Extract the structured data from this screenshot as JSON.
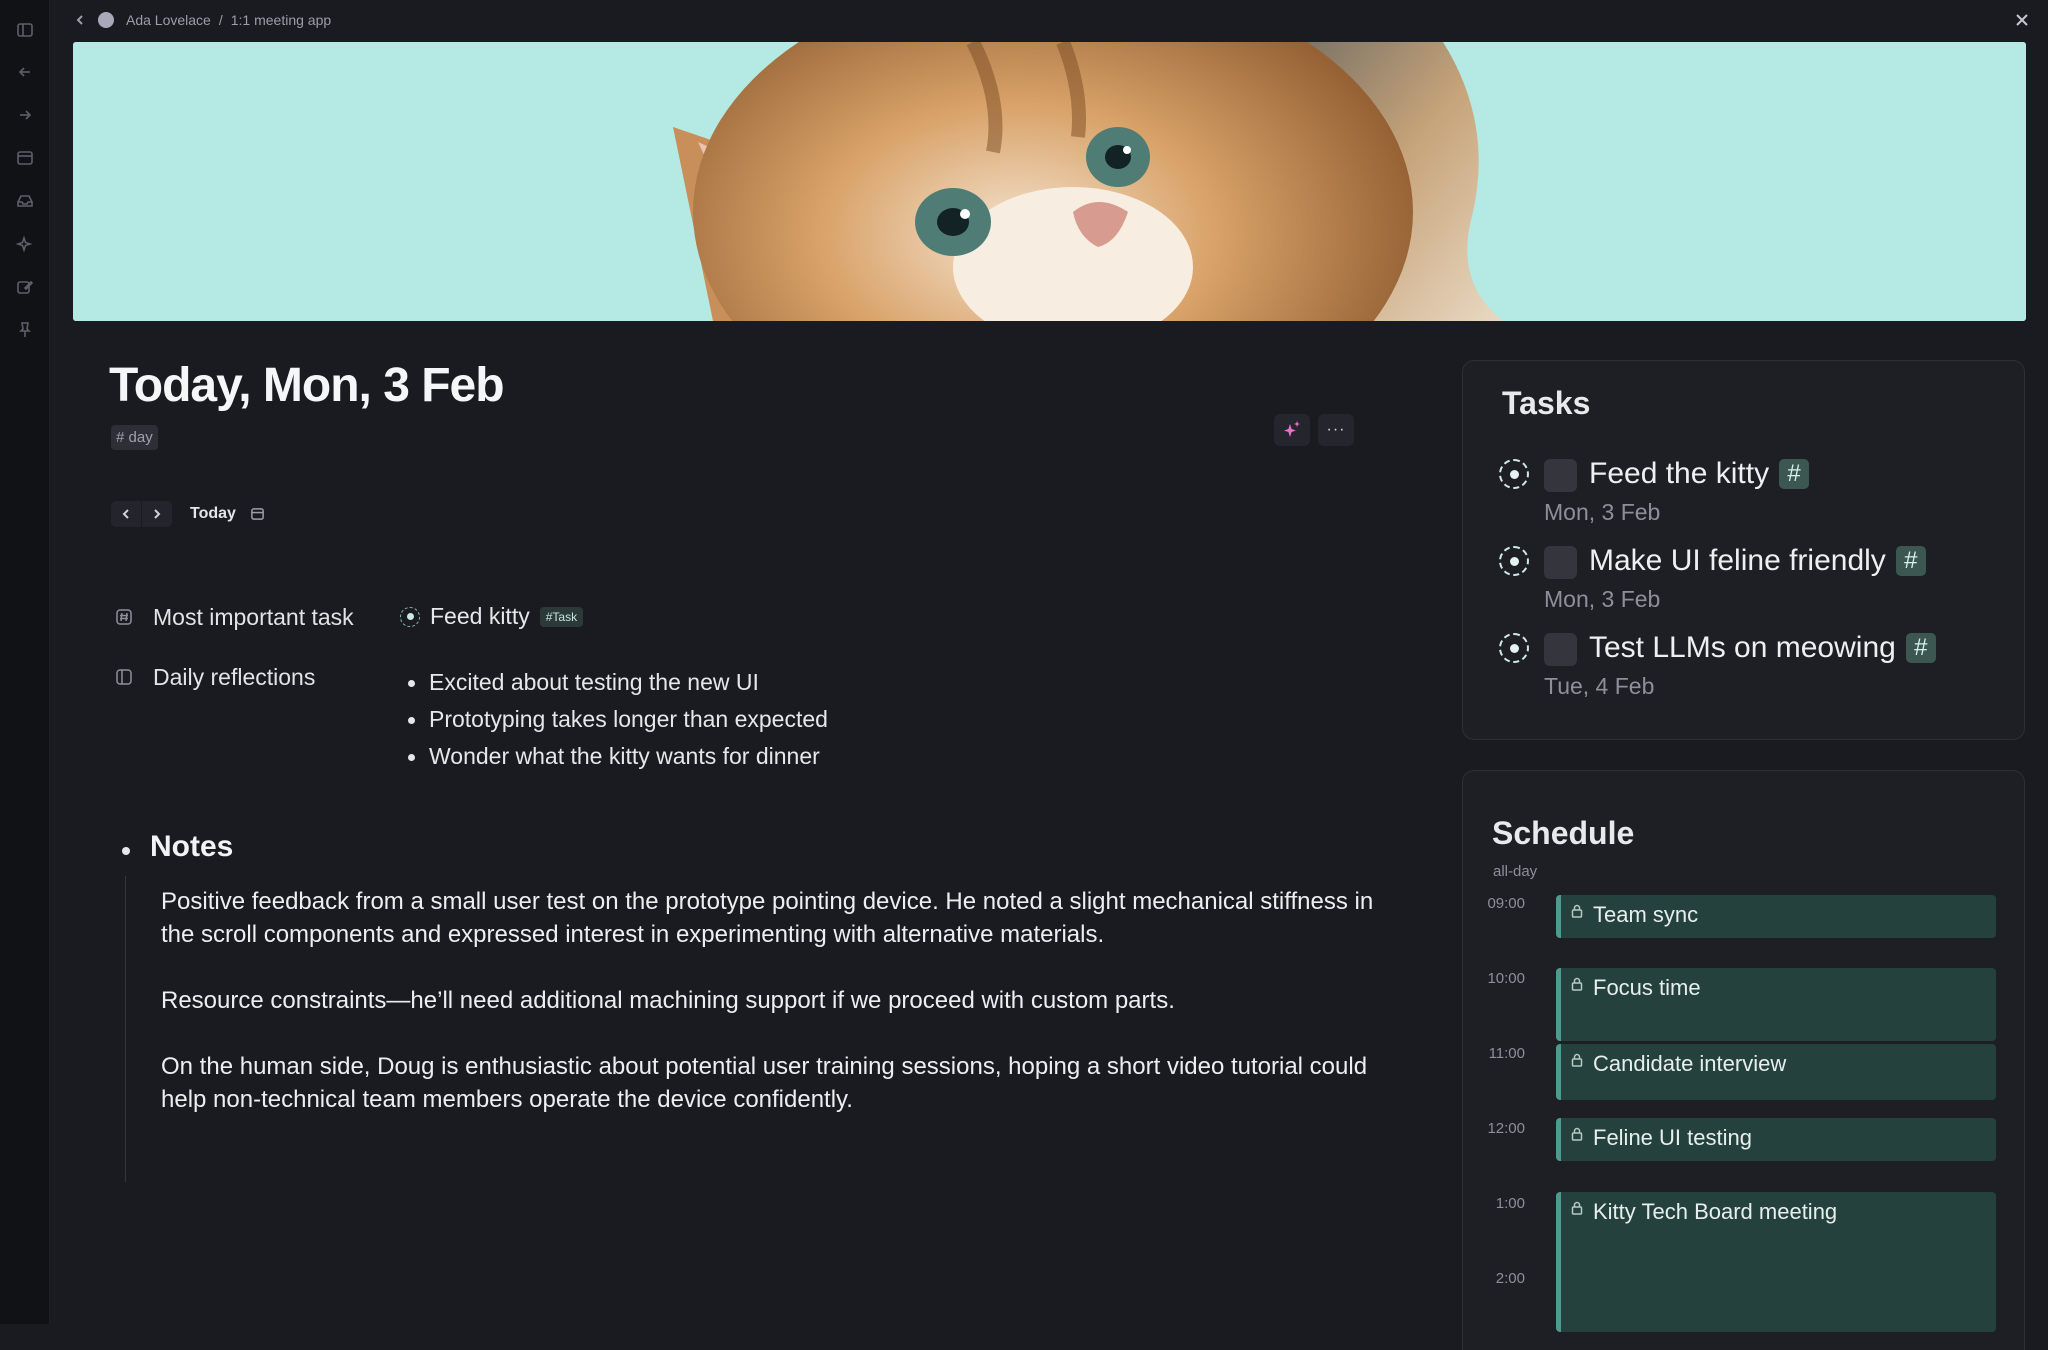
{
  "breadcrumb": {
    "user": "Ada Lovelace",
    "separator": "/",
    "page": "1:1 meeting app"
  },
  "rail_icons": [
    "sidebar-toggle-icon",
    "arrow-left-icon",
    "arrow-right-icon",
    "calendar-icon",
    "inbox-icon",
    "sparkle-icon",
    "edit-icon",
    "pin-icon"
  ],
  "header": {
    "title": "Today, Mon, 3 Feb",
    "tag": "# day",
    "today_label": "Today",
    "more_label": "···"
  },
  "properties": {
    "most_important_task": {
      "label": "Most important task",
      "value": "Feed kitty",
      "tag": "#Task"
    },
    "daily_reflections": {
      "label": "Daily reflections",
      "items": [
        "Excited about testing the new UI",
        "Prototyping takes longer than expected",
        "Wonder what the kitty wants for dinner"
      ]
    }
  },
  "notes": {
    "heading": "Notes",
    "paragraphs": [
      "Positive feedback from a small user test on the prototype pointing device. He noted a slight mechanical stiffness in the scroll components and expressed interest in experimenting with alternative materials.",
      "Resource constraints—he’ll need additional machining support if we proceed with custom parts.",
      "On the human side, Doug is enthusiastic about potential user training sessions, hoping a short video tutorial could help non-technical team members operate the device confidently."
    ]
  },
  "tasks": {
    "title": "Tasks",
    "items": [
      {
        "title": "Feed the kitty",
        "date": "Mon, 3 Feb",
        "hash": "#"
      },
      {
        "title": "Make UI feline friendly",
        "date": "Mon, 3 Feb",
        "hash": "#"
      },
      {
        "title": "Test LLMs on meowing",
        "date": "Tue, 4 Feb",
        "hash": "#"
      }
    ]
  },
  "schedule": {
    "title": "Schedule",
    "all_day_label": "all-day",
    "hours": [
      "09:00",
      "10:00",
      "11:00",
      "12:00",
      "1:00",
      "2:00"
    ],
    "events": [
      {
        "title": "Team sync",
        "locked": true
      },
      {
        "title": "Focus time",
        "locked": true
      },
      {
        "title": "Candidate interview",
        "locked": true
      },
      {
        "title": "Feline UI testing",
        "locked": true
      },
      {
        "title": "Kitty Tech Board meeting",
        "locked": true
      }
    ]
  },
  "colors": {
    "background": "#1a1b20",
    "accent": "#4e9a8d",
    "banner_sky": "#b4e9e4",
    "ai_sparkle": "#e573c9"
  }
}
